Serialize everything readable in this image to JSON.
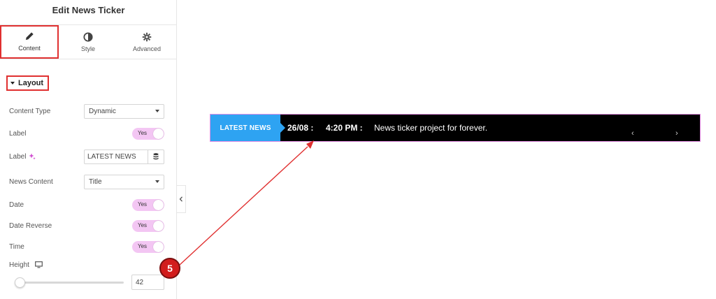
{
  "panel": {
    "title": "Edit News Ticker",
    "tabs": [
      {
        "label": "Content",
        "icon": "pencil-icon",
        "active": true
      },
      {
        "label": "Style",
        "icon": "half-circle-icon",
        "active": false
      },
      {
        "label": "Advanced",
        "icon": "gear-icon",
        "active": false
      }
    ],
    "section": {
      "title": "Layout"
    },
    "controls": {
      "content_type": {
        "label": "Content Type",
        "value": "Dynamic"
      },
      "label_toggle": {
        "label": "Label",
        "value": "Yes"
      },
      "label_text": {
        "label": "Label",
        "value": "LATEST NEWS"
      },
      "news_content": {
        "label": "News Content",
        "value": "Title"
      },
      "date": {
        "label": "Date",
        "value": "Yes"
      },
      "date_reverse": {
        "label": "Date Reverse",
        "value": "Yes"
      },
      "time": {
        "label": "Time",
        "value": "Yes"
      },
      "height": {
        "label": "Height",
        "value": "42",
        "slider_fraction": 0.05
      }
    }
  },
  "ticker": {
    "label": "LATEST NEWS",
    "date": "26/08 :",
    "time": "4:20 PM :",
    "title": "News ticker project for forever.",
    "prev": "‹",
    "next": "›"
  },
  "annotation": {
    "step": "5"
  },
  "colors": {
    "ticker_label_bg": "#2ea3f2",
    "ticker_bg": "#000000",
    "toggle_on": "#f3c6f3",
    "highlight": "#e03030",
    "badge": "#d21d1d"
  }
}
